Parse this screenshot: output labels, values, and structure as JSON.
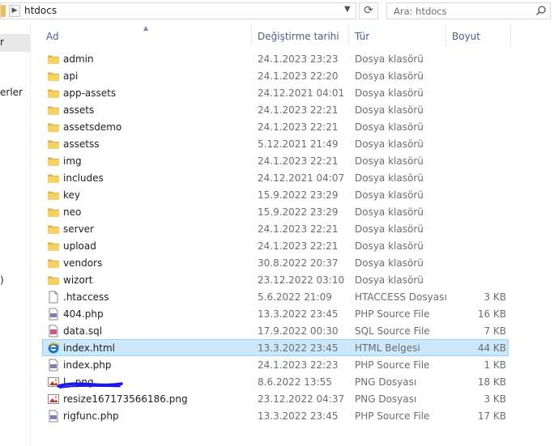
{
  "address": {
    "path": "htdocs"
  },
  "search": {
    "placeholder": "Ara: htdocs"
  },
  "nav": {
    "items": [
      "r",
      "erler",
      ")"
    ]
  },
  "columns": {
    "name": "Ad",
    "date": "Değiştirme tarihi",
    "type": "Tür",
    "size": "Boyut"
  },
  "files": [
    {
      "name": "admin",
      "date": "24.1.2023 23:23",
      "type": "Dosya klasörü",
      "size": "",
      "icon": "folder-icon"
    },
    {
      "name": "api",
      "date": "24.1.2023 22:20",
      "type": "Dosya klasörü",
      "size": "",
      "icon": "folder-icon"
    },
    {
      "name": "app-assets",
      "date": "24.12.2021 04:01",
      "type": "Dosya klasörü",
      "size": "",
      "icon": "folder-icon"
    },
    {
      "name": "assets",
      "date": "24.1.2023 22:21",
      "type": "Dosya klasörü",
      "size": "",
      "icon": "folder-icon"
    },
    {
      "name": "assetsdemo",
      "date": "24.1.2023 22:21",
      "type": "Dosya klasörü",
      "size": "",
      "icon": "folder-icon"
    },
    {
      "name": "assetss",
      "date": "5.12.2021 21:49",
      "type": "Dosya klasörü",
      "size": "",
      "icon": "folder-icon"
    },
    {
      "name": "img",
      "date": "24.1.2023 22:21",
      "type": "Dosya klasörü",
      "size": "",
      "icon": "folder-icon"
    },
    {
      "name": "includes",
      "date": "24.12.2021 04:07",
      "type": "Dosya klasörü",
      "size": "",
      "icon": "folder-icon"
    },
    {
      "name": "key",
      "date": "15.9.2022 23:29",
      "type": "Dosya klasörü",
      "size": "",
      "icon": "folder-icon"
    },
    {
      "name": "neo",
      "date": "15.9.2022 23:29",
      "type": "Dosya klasörü",
      "size": "",
      "icon": "folder-icon"
    },
    {
      "name": "server",
      "date": "24.1.2023 22:21",
      "type": "Dosya klasörü",
      "size": "",
      "icon": "folder-icon"
    },
    {
      "name": "upload",
      "date": "24.1.2023 22:21",
      "type": "Dosya klasörü",
      "size": "",
      "icon": "folder-icon"
    },
    {
      "name": "vendors",
      "date": "30.8.2022 20:37",
      "type": "Dosya klasörü",
      "size": "",
      "icon": "folder-icon"
    },
    {
      "name": "wizort",
      "date": "23.12.2022 03:10",
      "type": "Dosya klasörü",
      "size": "",
      "icon": "folder-icon"
    },
    {
      "name": ".htaccess",
      "date": "5.6.2022 21:09",
      "type": "HTACCESS Dosyası",
      "size": "3 KB",
      "icon": "blank-file-icon"
    },
    {
      "name": "404.php",
      "date": "13.3.2022 23:45",
      "type": "PHP Source File",
      "size": "16 KB",
      "icon": "php-file-icon"
    },
    {
      "name": "data.sql",
      "date": "17.9.2022 00:30",
      "type": "SQL Source File",
      "size": "7 KB",
      "icon": "sql-file-icon"
    },
    {
      "name": "index.html",
      "date": "13.3.2022 23:45",
      "type": "HTML Belgesi",
      "size": "44 KB",
      "icon": "html-file-icon",
      "selected": true
    },
    {
      "name": "index.php",
      "date": "24.1.2023 22:23",
      "type": "PHP Source File",
      "size": "1 KB",
      "icon": "php-file-icon"
    },
    {
      "name": "l...png",
      "date": "8.6.2022 13:55",
      "type": "PNG Dosyası",
      "size": "18 KB",
      "icon": "png-file-icon",
      "redacted": true
    },
    {
      "name": "resize167173566186.png",
      "date": "23.12.2022 04:37",
      "type": "PNG Dosyası",
      "size": "3 KB",
      "icon": "png-file-icon"
    },
    {
      "name": "rigfunc.php",
      "date": "13.3.2022 23:45",
      "type": "PHP Source File",
      "size": "17 KB",
      "icon": "php-file-icon"
    }
  ],
  "colors": {
    "selection_bg": "#cce8ff",
    "selection_border": "#99d1ff",
    "header_text": "#4d6082",
    "folder": "#f3c846",
    "redaction_scribble": "#1a1ae6"
  }
}
